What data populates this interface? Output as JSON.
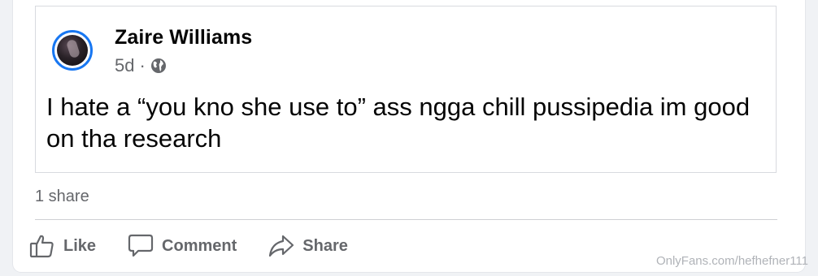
{
  "shared_post": {
    "author": "Zaire Williams",
    "time": "5d",
    "separator": "·",
    "privacy_icon": "globe-icon",
    "text": "I hate a “you kno she use to” ass ngga chill pussipedia im good on tha research"
  },
  "stats": {
    "shares": "1 share"
  },
  "actions": {
    "like": "Like",
    "comment": "Comment",
    "share": "Share"
  },
  "watermark": "OnlyFans.com/hefhefner111",
  "colors": {
    "avatar_ring": "#1877f2",
    "secondary_text": "#65676b",
    "primary_text": "#050505"
  }
}
